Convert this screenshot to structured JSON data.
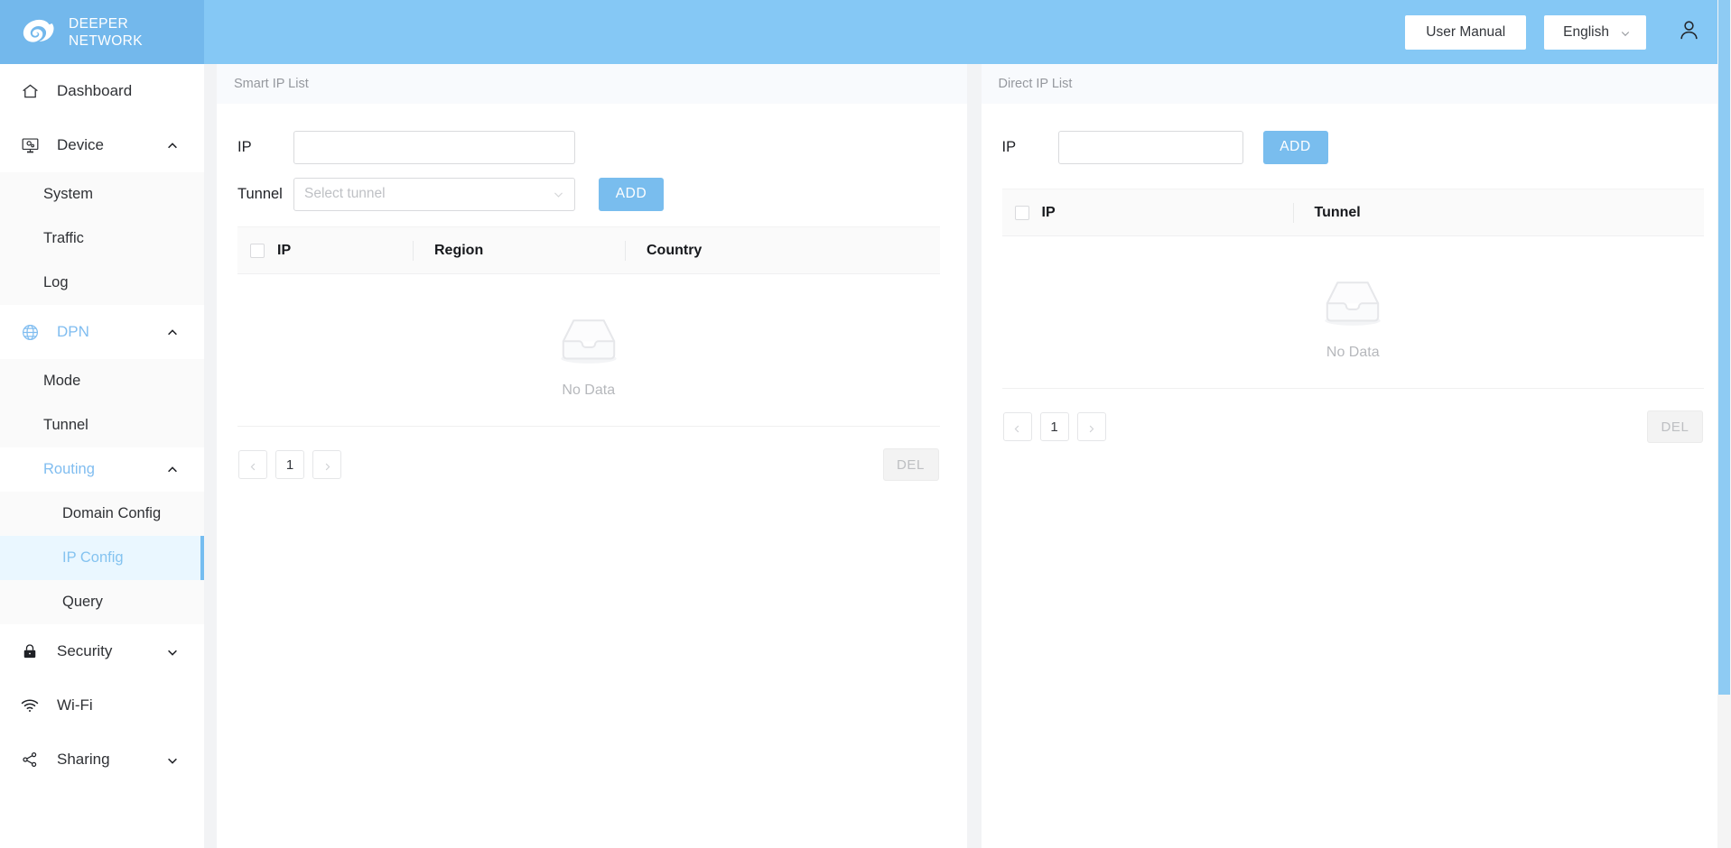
{
  "brand": {
    "line1": "DEEPER",
    "line2": "NETWORK",
    "logo_icon": "deeper-swirl-logo",
    "header_color": "#73b8ec"
  },
  "topbar": {
    "user_manual_label": "User Manual",
    "language_label": "English",
    "language_caret_icon": "chevron-down-icon",
    "account_icon": "user-avatar-icon",
    "background_color": "#85c8f5"
  },
  "sidebar": {
    "items": [
      {
        "label": "Dashboard",
        "icon": "home-icon"
      },
      {
        "label": "Device",
        "icon": "device-monitor-gear-icon",
        "caret": "chevron-up-icon",
        "expanded": true
      },
      {
        "label": "System"
      },
      {
        "label": "Traffic"
      },
      {
        "label": "Log"
      },
      {
        "label": "DPN",
        "icon": "globe-icon",
        "caret": "chevron-up-icon",
        "expanded": true,
        "active": true
      },
      {
        "label": "Mode"
      },
      {
        "label": "Tunnel"
      },
      {
        "label": "Routing",
        "caret": "chevron-up-icon",
        "expanded": true,
        "active": true
      },
      {
        "label": "Domain Config"
      },
      {
        "label": "IP Config",
        "selected": true
      },
      {
        "label": "Query"
      },
      {
        "label": "Security",
        "icon": "lock-icon",
        "caret": "chevron-down-icon",
        "expanded": false
      },
      {
        "label": "Wi-Fi",
        "icon": "wifi-icon"
      },
      {
        "label": "Sharing",
        "icon": "share-icon",
        "caret": "chevron-down-icon"
      }
    ],
    "selected_accent_color": "#76bdf0",
    "selected_background_color": "#eaf7ff"
  },
  "smart_panel": {
    "title": "Smart IP List",
    "ip_label": "IP",
    "ip_value": "",
    "ip_placeholder": "",
    "tunnel_label": "Tunnel",
    "tunnel_value": "Select tunnel",
    "tunnel_caret_icon": "chevron-down-icon",
    "add_label": "ADD",
    "select_all_icon": "checkbox-unchecked",
    "columns": [
      "IP",
      "Region",
      "Country"
    ],
    "rows": [],
    "empty_icon": "empty-box-icon",
    "empty_text": "No Data",
    "pagination": {
      "prev_icon": "chevron-left-icon",
      "pages": [
        "1"
      ],
      "current_page": "1",
      "next_icon": "chevron-right-icon"
    },
    "del_label": "DEL"
  },
  "direct_panel": {
    "title": "Direct IP List",
    "ip_label": "IP",
    "ip_value": "",
    "ip_placeholder": "",
    "add_label": "ADD",
    "select_all_icon": "checkbox-unchecked",
    "columns": [
      "IP",
      "Tunnel"
    ],
    "rows": [],
    "empty_icon": "empty-box-icon",
    "empty_text": "No Data",
    "pagination": {
      "prev_icon": "chevron-left-icon",
      "pages": [
        "1"
      ],
      "current_page": "1",
      "next_icon": "chevron-right-icon"
    },
    "del_label": "DEL"
  },
  "colors": {
    "primary_blue": "#79bdee",
    "header_blue": "#85c8f5",
    "scrollbar": "#8ecbf3",
    "page_bg": "#f2f3f5"
  }
}
